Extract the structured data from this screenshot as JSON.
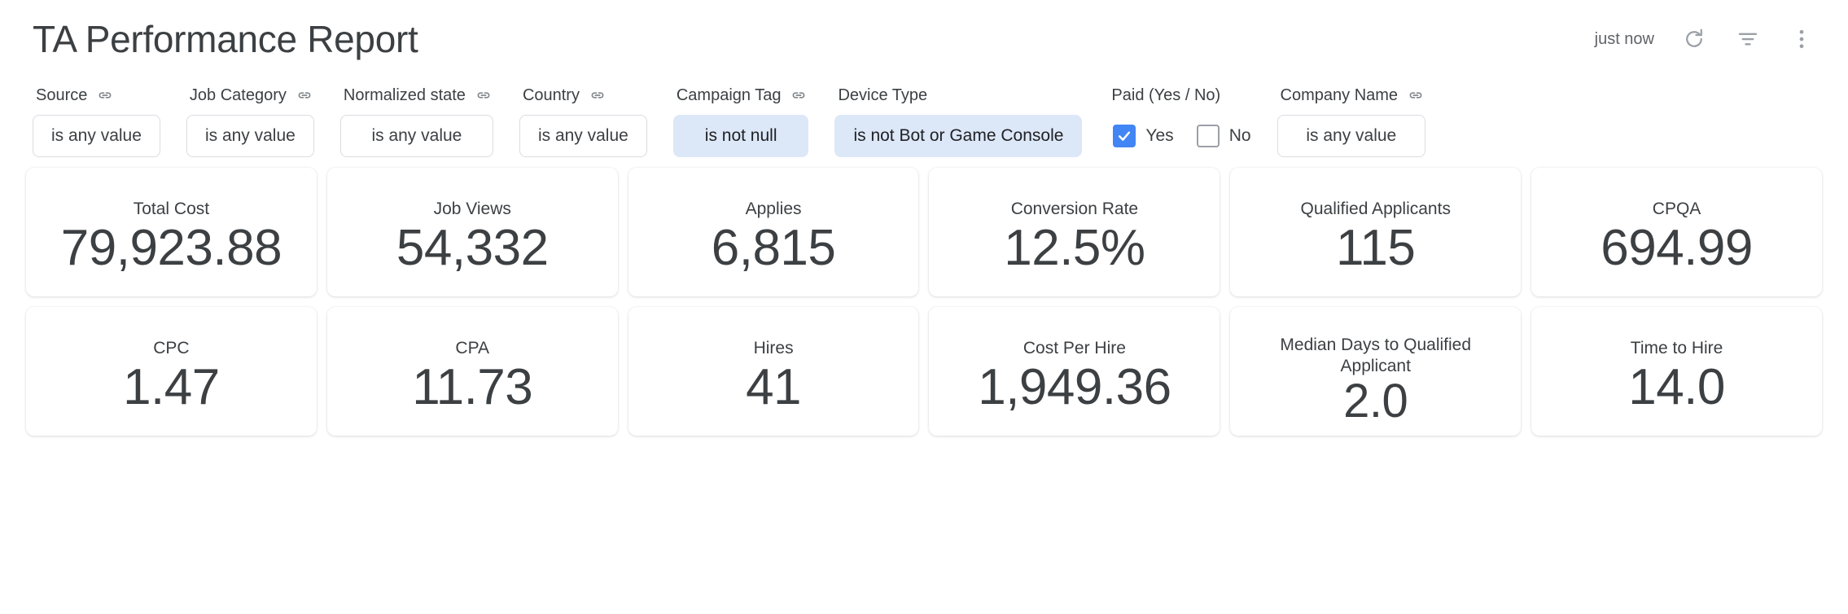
{
  "header": {
    "title": "TA Performance Report",
    "refresh_status": "just now",
    "icons": [
      "refresh-icon",
      "filter-icon",
      "more-options-icon"
    ]
  },
  "filters": [
    {
      "label": "Source",
      "has_link_icon": true,
      "type": "chip",
      "value": "is any value",
      "active": false,
      "wide": false
    },
    {
      "label": "Job Category",
      "has_link_icon": true,
      "type": "chip",
      "value": "is any value",
      "active": false,
      "wide": false
    },
    {
      "label": "Normalized state",
      "has_link_icon": true,
      "type": "chip",
      "value": "is any value",
      "active": false,
      "wide": false
    },
    {
      "label": "Country",
      "has_link_icon": true,
      "type": "chip",
      "value": "is any value",
      "active": false,
      "wide": false
    },
    {
      "label": "Campaign Tag",
      "has_link_icon": true,
      "type": "chip",
      "value": "is not null",
      "active": true,
      "wide": false
    },
    {
      "label": "Device Type",
      "has_link_icon": false,
      "type": "chip",
      "value": "is not Bot or Game Console",
      "active": true,
      "wide": true
    },
    {
      "label": "Paid (Yes / No)",
      "has_link_icon": false,
      "type": "checkbox",
      "options": [
        {
          "label": "Yes",
          "checked": true
        },
        {
          "label": "No",
          "checked": false
        }
      ]
    },
    {
      "label": "Company Name",
      "has_link_icon": true,
      "type": "chip",
      "value": "is any value",
      "active": false,
      "wide": false
    }
  ],
  "kpi_rows": [
    [
      {
        "title": "Total Cost",
        "value": "79,923.88"
      },
      {
        "title": "Job Views",
        "value": "54,332"
      },
      {
        "title": "Applies",
        "value": "6,815"
      },
      {
        "title": "Conversion Rate",
        "value": "12.5%"
      },
      {
        "title": "Qualified Applicants",
        "value": "115"
      },
      {
        "title": "CPQA",
        "value": "694.99"
      }
    ],
    [
      {
        "title": "CPC",
        "value": "1.47"
      },
      {
        "title": "CPA",
        "value": "11.73"
      },
      {
        "title": "Hires",
        "value": "41"
      },
      {
        "title": "Cost Per Hire",
        "value": "1,949.36"
      },
      {
        "title": "Median Days to Qualified Applicant",
        "value": "2.0",
        "two_line": true
      },
      {
        "title": "Time to Hire",
        "value": "14.0"
      }
    ]
  ],
  "colors": {
    "accent_blue": "#4285f4",
    "active_chip_bg": "#dce7f8",
    "text_primary": "#3c4043",
    "text_muted": "#5f6368",
    "border": "#dadce0"
  }
}
